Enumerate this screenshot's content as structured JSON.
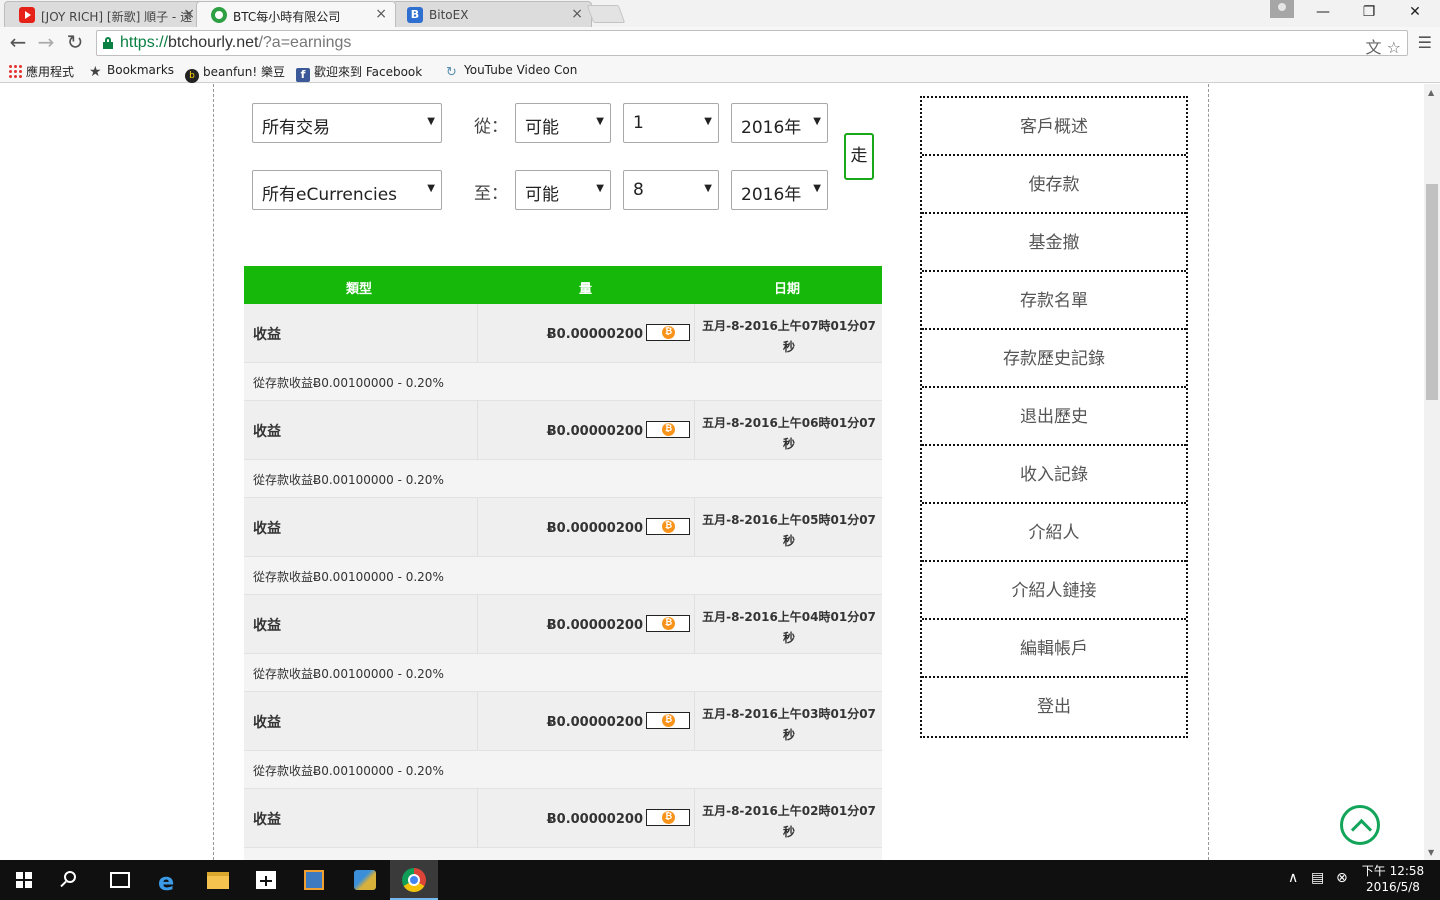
{
  "browser": {
    "tabs": [
      {
        "title": "[JOY RICH] [新歌] 順子 - 遠",
        "close": "×"
      },
      {
        "title": "BTC每小時有限公司",
        "close": "×"
      },
      {
        "title": "BitoEX",
        "close": "×"
      }
    ],
    "url_scheme": "https://",
    "url_host": "btchourly.net",
    "url_path": "/?a=earnings",
    "bookmarks": [
      {
        "label": "應用程式",
        "icon": "apps-icon"
      },
      {
        "label": "Bookmarks",
        "icon": "star-icon"
      },
      {
        "label": "beanfun! 樂豆",
        "icon": "beanfun-icon"
      },
      {
        "label": "歡迎來到 Facebook",
        "icon": "facebook-icon"
      },
      {
        "label": "YouTube Video Con",
        "icon": "youtube-converter-icon"
      }
    ]
  },
  "filters": {
    "type_select": "所有交易",
    "currency_select": "所有eCurrencies",
    "from_label": "從：",
    "to_label": "至：",
    "from_month": "可能",
    "from_day": "1",
    "from_year": "2016年",
    "to_month": "可能",
    "to_day": "8",
    "to_year": "2016年",
    "go_label": "走"
  },
  "table": {
    "headers": [
      "類型",
      "量",
      "日期"
    ],
    "rows": [
      {
        "type": "收益",
        "amount": "Ƀ0.00000200",
        "date": "五月-8-2016上午07時01分07秒",
        "detail": "從存款收益Ƀ0.00100000 - 0.20%"
      },
      {
        "type": "收益",
        "amount": "Ƀ0.00000200",
        "date": "五月-8-2016上午06時01分07秒",
        "detail": "從存款收益Ƀ0.00100000 - 0.20%"
      },
      {
        "type": "收益",
        "amount": "Ƀ0.00000200",
        "date": "五月-8-2016上午05時01分07秒",
        "detail": "從存款收益Ƀ0.00100000 - 0.20%"
      },
      {
        "type": "收益",
        "amount": "Ƀ0.00000200",
        "date": "五月-8-2016上午04時01分07秒",
        "detail": "從存款收益Ƀ0.00100000 - 0.20%"
      },
      {
        "type": "收益",
        "amount": "Ƀ0.00000200",
        "date": "五月-8-2016上午03時01分07秒",
        "detail": "從存款收益Ƀ0.00100000 - 0.20%"
      },
      {
        "type": "收益",
        "amount": "Ƀ0.00000200",
        "date": "五月-8-2016上午02時01分07秒",
        "detail": ""
      }
    ]
  },
  "sidebar": {
    "items": [
      "客戶概述",
      "使存款",
      "基金撤",
      "存款名單",
      "存款歷史記錄",
      "退出歷史",
      "收入記錄",
      "介紹人",
      "介紹人鏈接",
      "編輯帳戶",
      "登出"
    ]
  },
  "taskbar": {
    "clock_period_time": "下午 12:58",
    "clock_date": "2016/5/8"
  },
  "colors": {
    "table_header": "#16b80a",
    "go_border": "#18a81a",
    "back_to_top": "#12a55a",
    "bitcoin": "#f7931a"
  }
}
